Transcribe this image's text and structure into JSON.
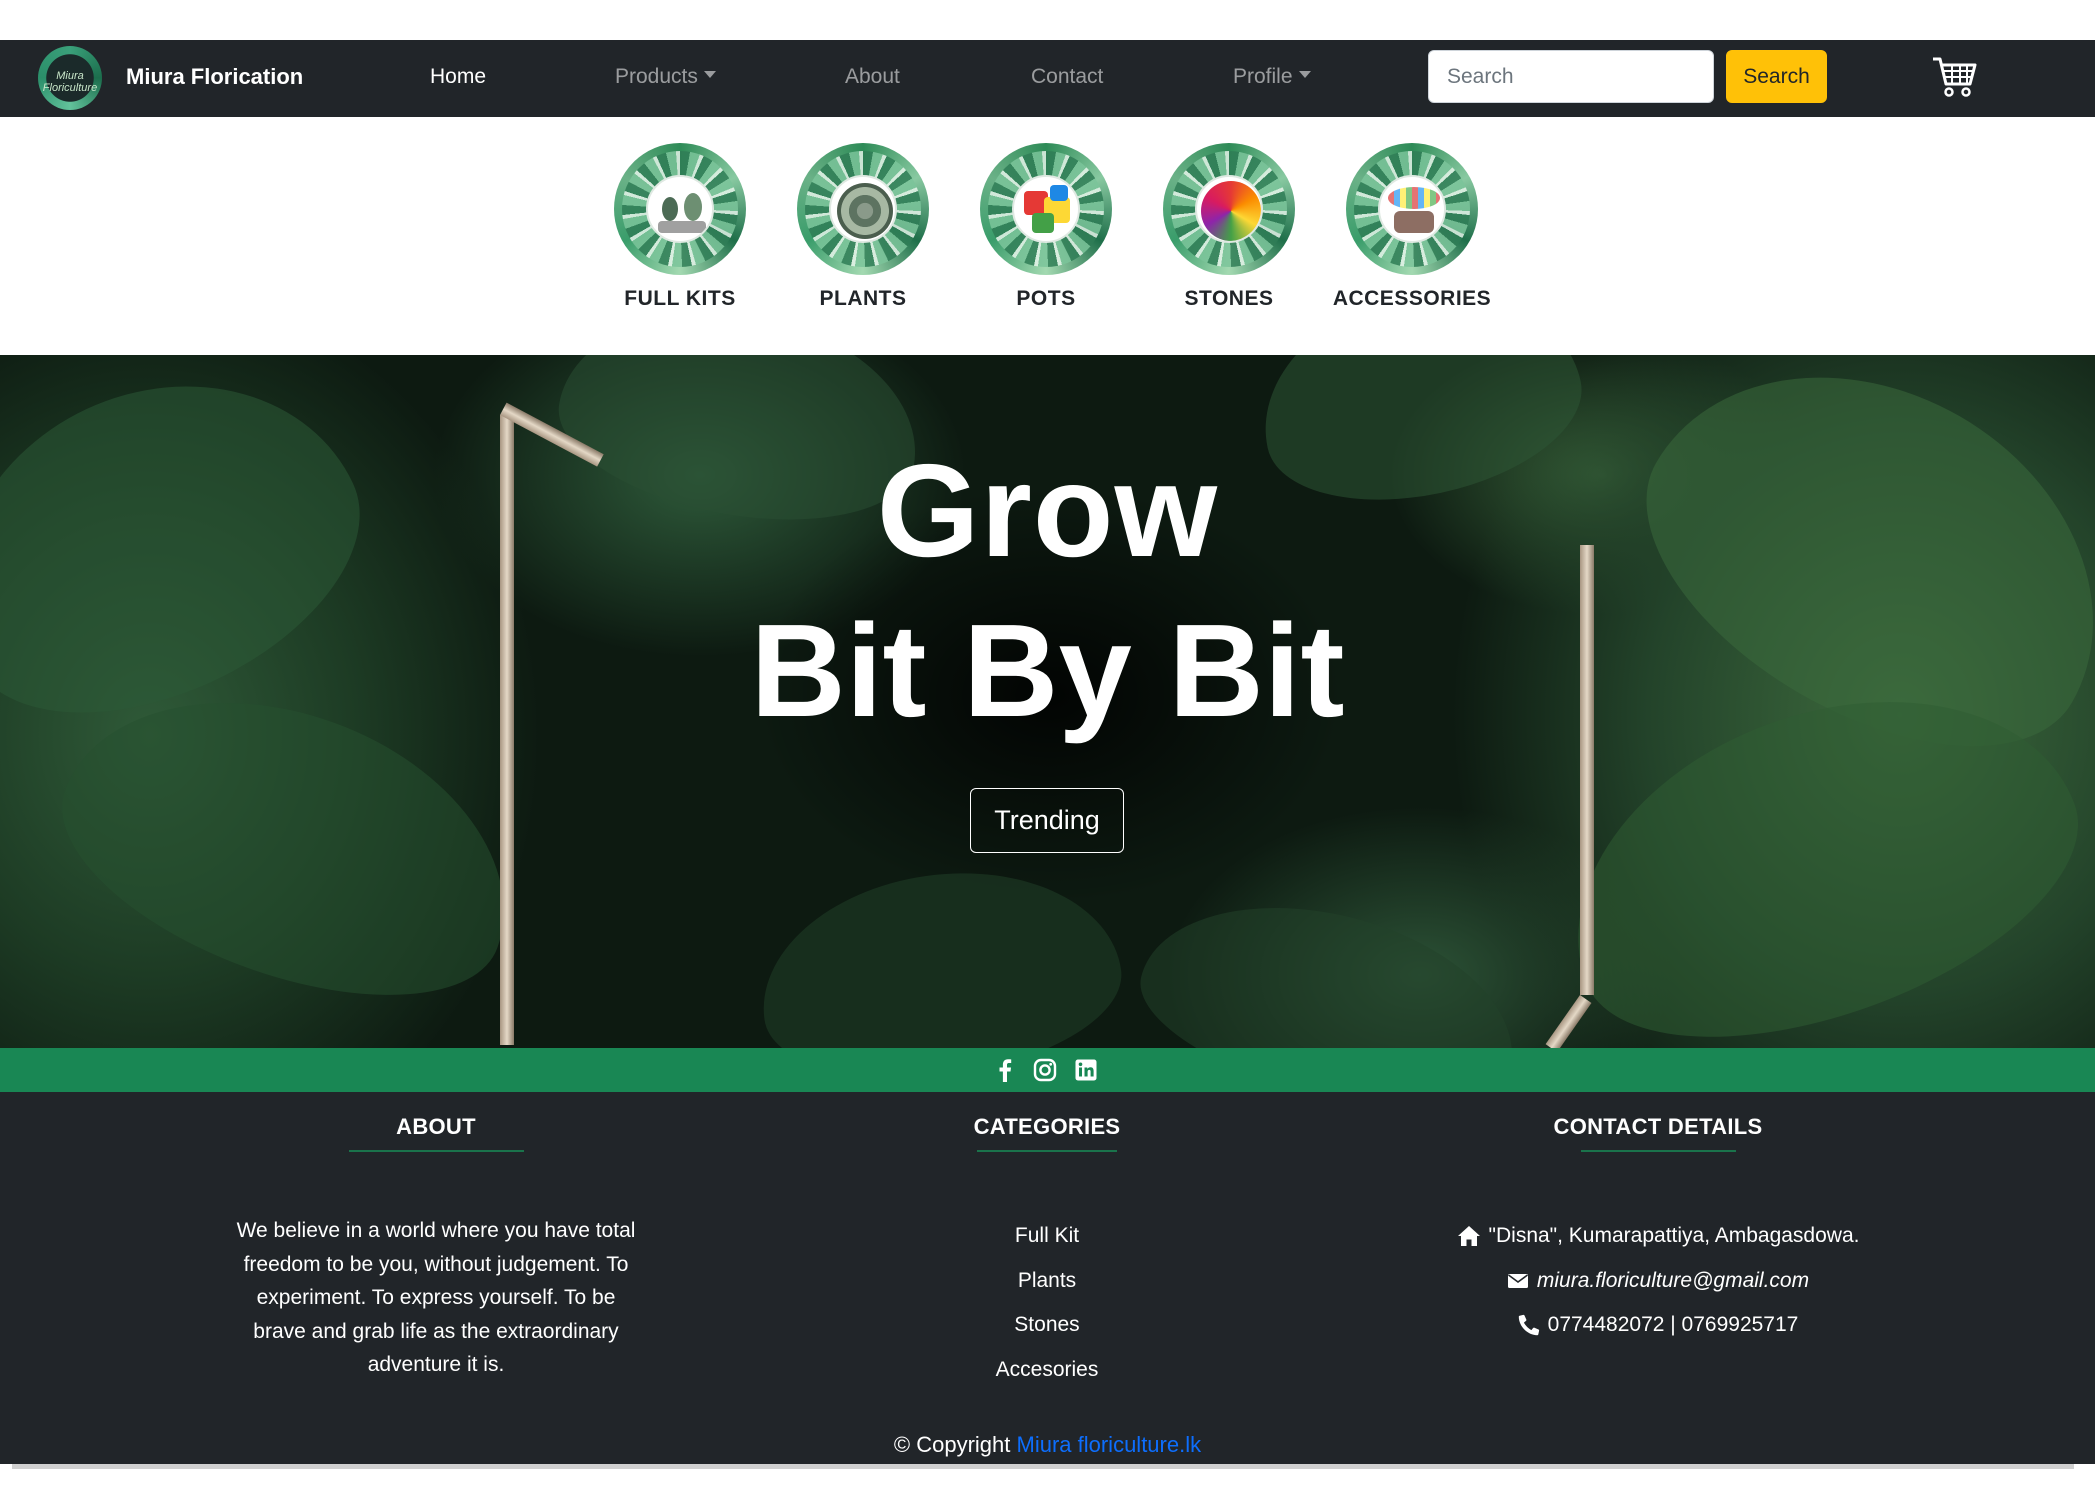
{
  "navbar": {
    "logo_text": "Miura Floriculture",
    "brand": "Miura Florication",
    "links": {
      "home": "Home",
      "products": "Products",
      "about": "About",
      "contact": "Contact",
      "profile": "Profile"
    },
    "search": {
      "placeholder": "Search",
      "button": "Search"
    },
    "icons": {
      "cart": "shopping-cart-icon"
    }
  },
  "categories": [
    {
      "label": "FULL KITS"
    },
    {
      "label": "PLANTS"
    },
    {
      "label": "POTS"
    },
    {
      "label": "STONES"
    },
    {
      "label": "ACCESSORIES"
    }
  ],
  "hero": {
    "line1": "Grow",
    "line2": "Bit By Bit",
    "button": "Trending"
  },
  "social": [
    "facebook-icon",
    "instagram-icon",
    "linkedin-icon"
  ],
  "footer": {
    "about": {
      "heading": "ABOUT",
      "lines": [
        "We believe in a world where you have total",
        "freedom to be you, without judgement. To",
        "experiment. To express yourself. To be",
        "brave and grab life as the extraordinary",
        "adventure it is."
      ]
    },
    "categories": {
      "heading": "CATEGORIES",
      "links": [
        "Full Kit",
        "Plants",
        "Stones",
        "Accesories"
      ]
    },
    "contact": {
      "heading": "CONTACT DETAILS",
      "address": "\"Disna\", Kumarapattiya, Ambagasdowa.",
      "email": "miura.floriculture@gmail.com",
      "phone": "0774482072 | 0769925717"
    },
    "copyright_prefix": "© Copyright",
    "copyright_link": "Miura floriculture.lk"
  },
  "colors": {
    "navbar_bg": "#212529",
    "accent_yellow": "#ffc107",
    "social_green": "#198754",
    "link_blue": "#0d6efd"
  }
}
